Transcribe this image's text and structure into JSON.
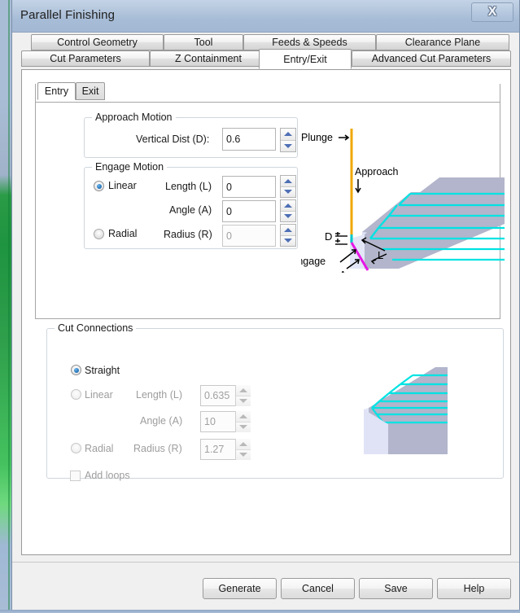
{
  "window": {
    "title": "Parallel Finishing",
    "close_label": "X"
  },
  "outer_tabs": {
    "row1": [
      {
        "label": "Control Geometry",
        "active": false
      },
      {
        "label": "Tool",
        "active": false
      },
      {
        "label": "Feeds & Speeds",
        "active": false
      },
      {
        "label": "Clearance Plane",
        "active": false
      }
    ],
    "row2": [
      {
        "label": "Cut Parameters",
        "active": false
      },
      {
        "label": "Z Containment",
        "active": false
      },
      {
        "label": "Entry/Exit",
        "active": true
      },
      {
        "label": "Advanced Cut Parameters",
        "active": false
      }
    ]
  },
  "inner_tabs": [
    {
      "label": "Entry",
      "active": true
    },
    {
      "label": "Exit",
      "active": false
    }
  ],
  "approach_motion": {
    "title": "Approach Motion",
    "vertical_dist_label": "Vertical Dist (D):",
    "vertical_dist_value": "0.6"
  },
  "engage_motion": {
    "title": "Engage Motion",
    "linear_label": "Linear",
    "linear_selected": true,
    "radial_label": "Radial",
    "radial_selected": false,
    "length_label": "Length (L)",
    "length_value": "0",
    "angle_label": "Angle (A)",
    "angle_value": "0",
    "radius_label": "Radius (R)",
    "radius_value": "0"
  },
  "entry_diagram": {
    "plunge_label": "Plunge",
    "approach_label": "Approach",
    "engage_label": "Engage",
    "d_label": "D",
    "l_label": "L",
    "a_label": "A",
    "plunge_color": "#f0a800",
    "engage_color": "#e617e6",
    "toolpath_color": "#00e5e5",
    "part_top_color": "#b3b6cc",
    "part_side_color": "#dfe3f5"
  },
  "cut_connections": {
    "title": "Cut Connections",
    "straight_label": "Straight",
    "straight_selected": true,
    "linear_label": "Linear",
    "linear_selected": false,
    "radial_label": "Radial",
    "radial_selected": false,
    "length_label": "Length (L)",
    "length_value": "0.635",
    "angle_label": "Angle (A)",
    "angle_value": "10",
    "radius_label": "Radius (R)",
    "radius_value": "1.27",
    "add_loops_label": "Add loops",
    "add_loops_checked": false
  },
  "buttons": [
    {
      "label": "Generate"
    },
    {
      "label": "Cancel"
    },
    {
      "label": "Save"
    },
    {
      "label": "Help"
    }
  ]
}
